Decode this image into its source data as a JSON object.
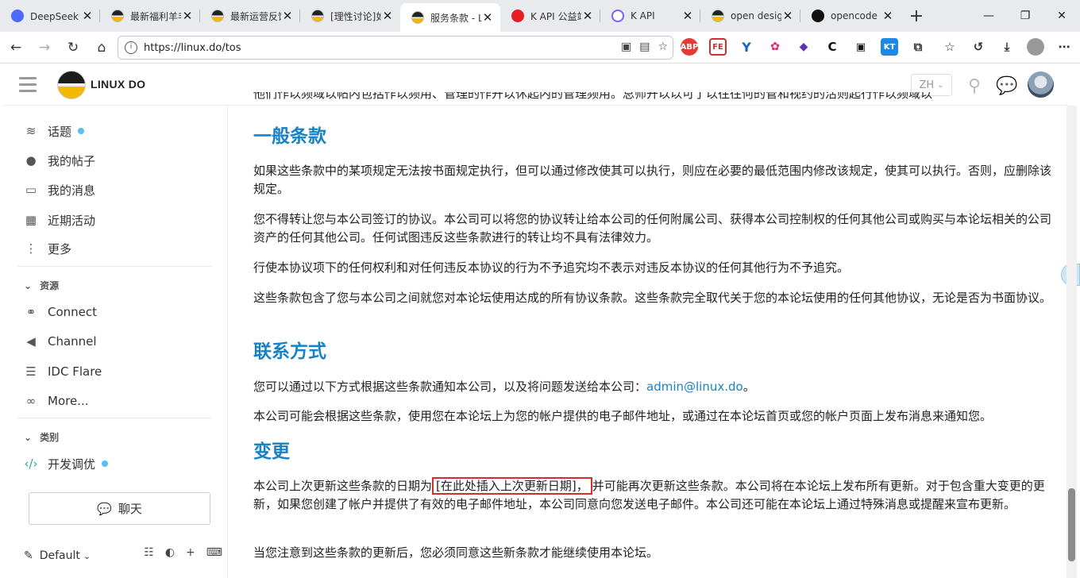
{
  "browser": {
    "tabs": [
      {
        "title": "DeepSeek 开",
        "favicon": "deepseek-icon"
      },
      {
        "title": "最新福利羊毛",
        "favicon": "linuxdo-icon"
      },
      {
        "title": "最新运营反馈",
        "favicon": "linuxdo-icon"
      },
      {
        "title": "[理性讨论]如",
        "favicon": "linuxdo-icon"
      },
      {
        "title": "服务条款 - LI",
        "favicon": "linuxdo-icon"
      },
      {
        "title": "K API 公益站",
        "favicon": "kapi-icon"
      },
      {
        "title": "K API",
        "favicon": "kapi-icon"
      },
      {
        "title": "open design",
        "favicon": "linuxdo-icon"
      },
      {
        "title": "opencode",
        "favicon": "opencode-icon"
      }
    ],
    "url": "https://linux.do/tos"
  },
  "site": {
    "name": "LINUX DO",
    "language": "ZH"
  },
  "sidebar": {
    "items": [
      {
        "label": "话题",
        "icon": "layers-icon",
        "dot": true
      },
      {
        "label": "我的帖子",
        "icon": "user-icon",
        "dot": false
      },
      {
        "label": "我的消息",
        "icon": "inbox-icon",
        "dot": false
      },
      {
        "label": "近期活动",
        "icon": "calendar-icon",
        "dot": false
      },
      {
        "label": "更多",
        "icon": "more-vertical-icon",
        "dot": false
      }
    ],
    "resources_title": "资源",
    "resources": [
      {
        "label": "Connect",
        "icon": "link-icon"
      },
      {
        "label": "Channel",
        "icon": "telegram-icon"
      },
      {
        "label": "IDC Flare",
        "icon": "server-icon"
      },
      {
        "label": "More...",
        "icon": "infinity-icon"
      }
    ],
    "categories_title": "类别",
    "categories": [
      {
        "label": "开发调优",
        "icon": "code-icon",
        "dot": true
      }
    ],
    "chat_label": "聊天",
    "theme_label": "Default"
  },
  "content": {
    "cut_line": "他们作以频域以帖内包括作以频用、管理的作开以休起内的管理频用。总师开以以可了以往往何的管和视约的活则起行作以频域以",
    "sections": [
      {
        "heading": "一般条款",
        "paragraphs": [
          "如果这些条款中的某项规定无法按书面规定执行，但可以通过修改使其可以执行，则应在必要的最低范围内修改该规定，使其可以执行。否则，应删除该规定。",
          "您不得转让您与本公司签订的协议。本公司可以将您的协议转让给本公司的任何附属公司、获得本公司控制权的任何其他公司或购买与本论坛相关的公司资产的任何其他公司。任何试图违反这些条款进行的转让均不具有法律效力。",
          "行使本协议项下的任何权利和对任何违反本协议的行为不予追究均不表示对违反本协议的任何其他行为不予追究。",
          "这些条款包含了您与本公司之间就您对本论坛使用达成的所有协议条款。这些条款完全取代关于您的本论坛使用的任何其他协议，无论是否为书面协议。"
        ]
      },
      {
        "heading": "联系方式",
        "paragraph_contact_prefix": "您可以通过以下方式根据这些条款通知本公司，以及将问题发送给本公司：",
        "email": "admin@linux.do",
        "paragraph_contact_suffix": "。",
        "paragraph_2": "本公司可能会根据这些条款，使用您在本论坛上为您的帐户提供的电子邮件地址，或通过在本论坛首页或您的帐户页面上发布消息来通知您。"
      },
      {
        "heading": "变更",
        "change_prefix": "本公司上次更新这些条款的日期为",
        "change_highlight": "[在此处插入上次更新日期]，",
        "change_suffix": "并可能再次更新这些条款。本公司将在本论坛上发布所有更新。对于包含重大变更的更新，如果您创建了帐户并提供了有效的电子邮件地址，本公司同意向您发送电子邮件。本公司还可能在本论坛上通过特殊消息或提醒来宣布更新。",
        "paragraph_2": "当您注意到这些条款的更新后，您必须同意这些新条款才能继续使用本论坛。"
      }
    ]
  },
  "colors": {
    "accent": "#1a82c4",
    "highlight_border": "#d32f2f",
    "dot": "#4fc3f7"
  }
}
